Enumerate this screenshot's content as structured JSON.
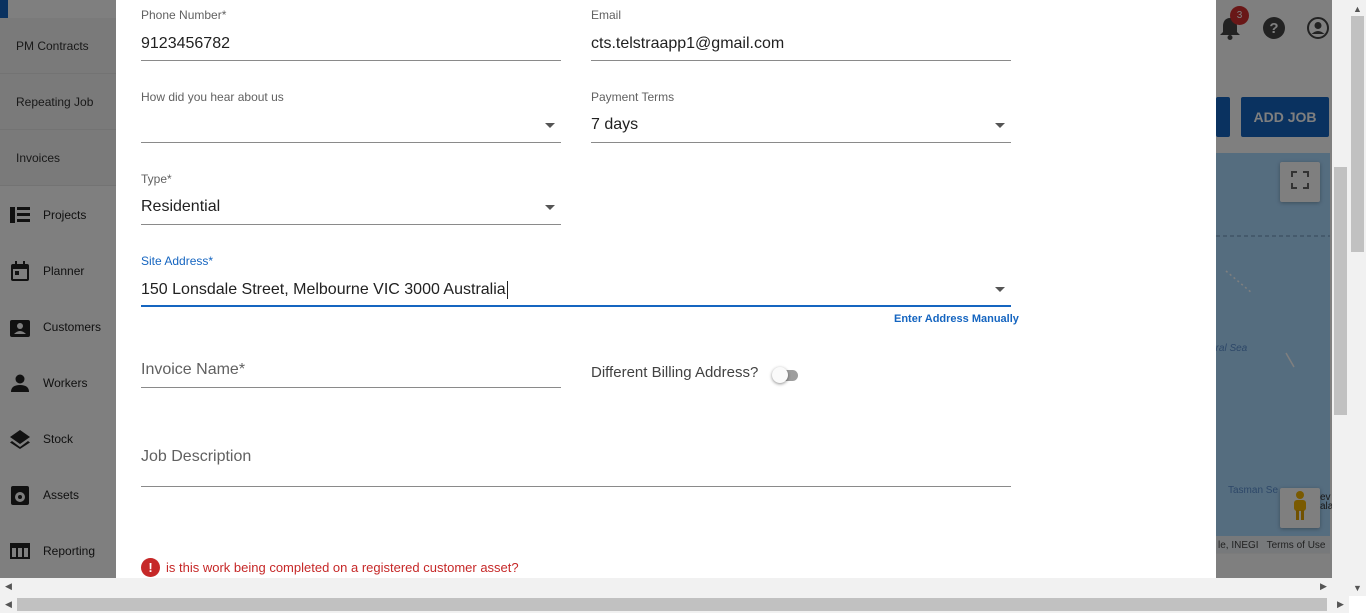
{
  "sidebar": {
    "sub_items": [
      {
        "label": "PM Contracts"
      },
      {
        "label": "Repeating Job"
      },
      {
        "label": "Invoices"
      }
    ],
    "items": [
      {
        "label": "Projects",
        "icon": "list-icon"
      },
      {
        "label": "Planner",
        "icon": "calendar-icon"
      },
      {
        "label": "Customers",
        "icon": "contact-card-icon"
      },
      {
        "label": "Workers",
        "icon": "person-icon"
      },
      {
        "label": "Stock",
        "icon": "layers-icon"
      },
      {
        "label": "Assets",
        "icon": "asset-icon"
      },
      {
        "label": "Reporting",
        "icon": "table-icon"
      }
    ]
  },
  "header": {
    "notification_count": "3",
    "add_job_label": "ADD JOB"
  },
  "map": {
    "label_coral_sea": "oral Sea",
    "label_tasman": "Tasman Se",
    "label_partial": "ev ala",
    "attribution": "le, INEGI",
    "terms": "Terms of Use"
  },
  "form": {
    "phone": {
      "label": "Phone Number*",
      "value": "9123456782"
    },
    "email": {
      "label": "Email",
      "value": "cts.telstraapp1@gmail.com"
    },
    "hear_about": {
      "label": "How did you hear about us",
      "value": ""
    },
    "payment_terms": {
      "label": "Payment Terms",
      "value": "7 days"
    },
    "type": {
      "label": "Type*",
      "value": "Residential"
    },
    "site_address": {
      "label": "Site Address*",
      "value": "150 Lonsdale Street, Melbourne VIC 3000 Australia"
    },
    "enter_manually": "Enter Address Manually",
    "invoice_name": {
      "placeholder": "Invoice Name*"
    },
    "billing_toggle": {
      "label": "Different Billing Address?",
      "on": false
    },
    "job_description": {
      "placeholder": "Job Description"
    },
    "asset_warning": "is this work being completed on a registered customer asset?"
  },
  "colors": {
    "accent": "#1565c0",
    "error": "#c62828"
  }
}
